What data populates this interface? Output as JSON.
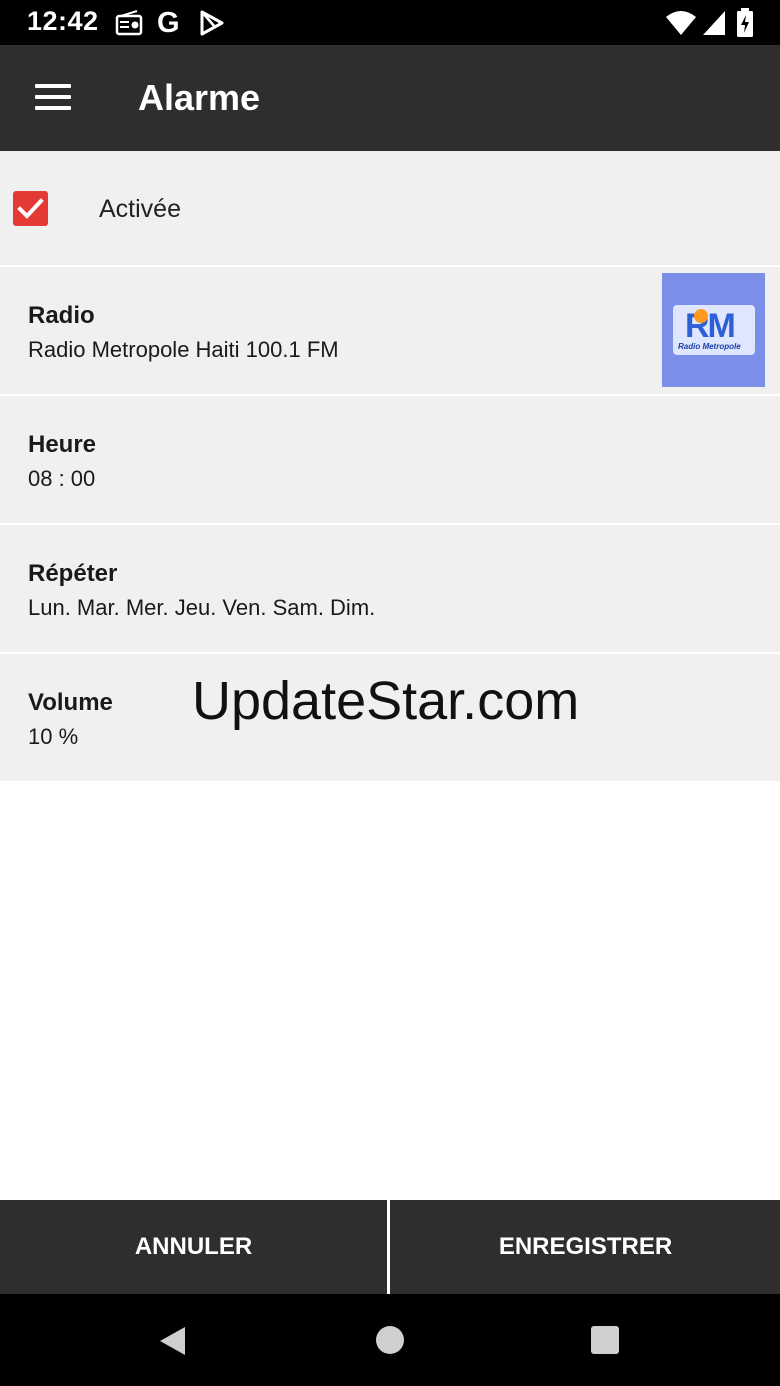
{
  "status_bar": {
    "time": "12:42",
    "icons": [
      "radio-icon",
      "google-icon",
      "play-store-icon",
      "wifi-icon",
      "signal-icon",
      "battery-icon"
    ],
    "g_glyph": "G"
  },
  "app_bar": {
    "title": "Alarme",
    "menu_icon": "menu-icon"
  },
  "alarm": {
    "enabled": {
      "label": "Activée",
      "checked": true,
      "checkbox_color": "#e53935"
    },
    "radio": {
      "title": "Radio",
      "value": "Radio Metropole Haiti 100.1 FM",
      "logo": {
        "mark": "RM",
        "subtitle": "Radio Metropole"
      }
    },
    "time": {
      "title": "Heure",
      "value": "08 : 00"
    },
    "repeat": {
      "title": "Répéter",
      "value": "Lun. Mar. Mer. Jeu. Ven. Sam. Dim."
    },
    "volume": {
      "title": "Volume",
      "value": "10 %"
    }
  },
  "watermark": "UpdateStar.com",
  "actions": {
    "cancel_label": "ANNULER",
    "save_label": "ENREGISTRER"
  },
  "nav_bar": {
    "icons": [
      "back-icon",
      "home-icon",
      "recents-icon"
    ]
  },
  "colors": {
    "app_bar": "#2e2e2e",
    "list_background": "#f0f0f0",
    "accent": "#e53935"
  }
}
